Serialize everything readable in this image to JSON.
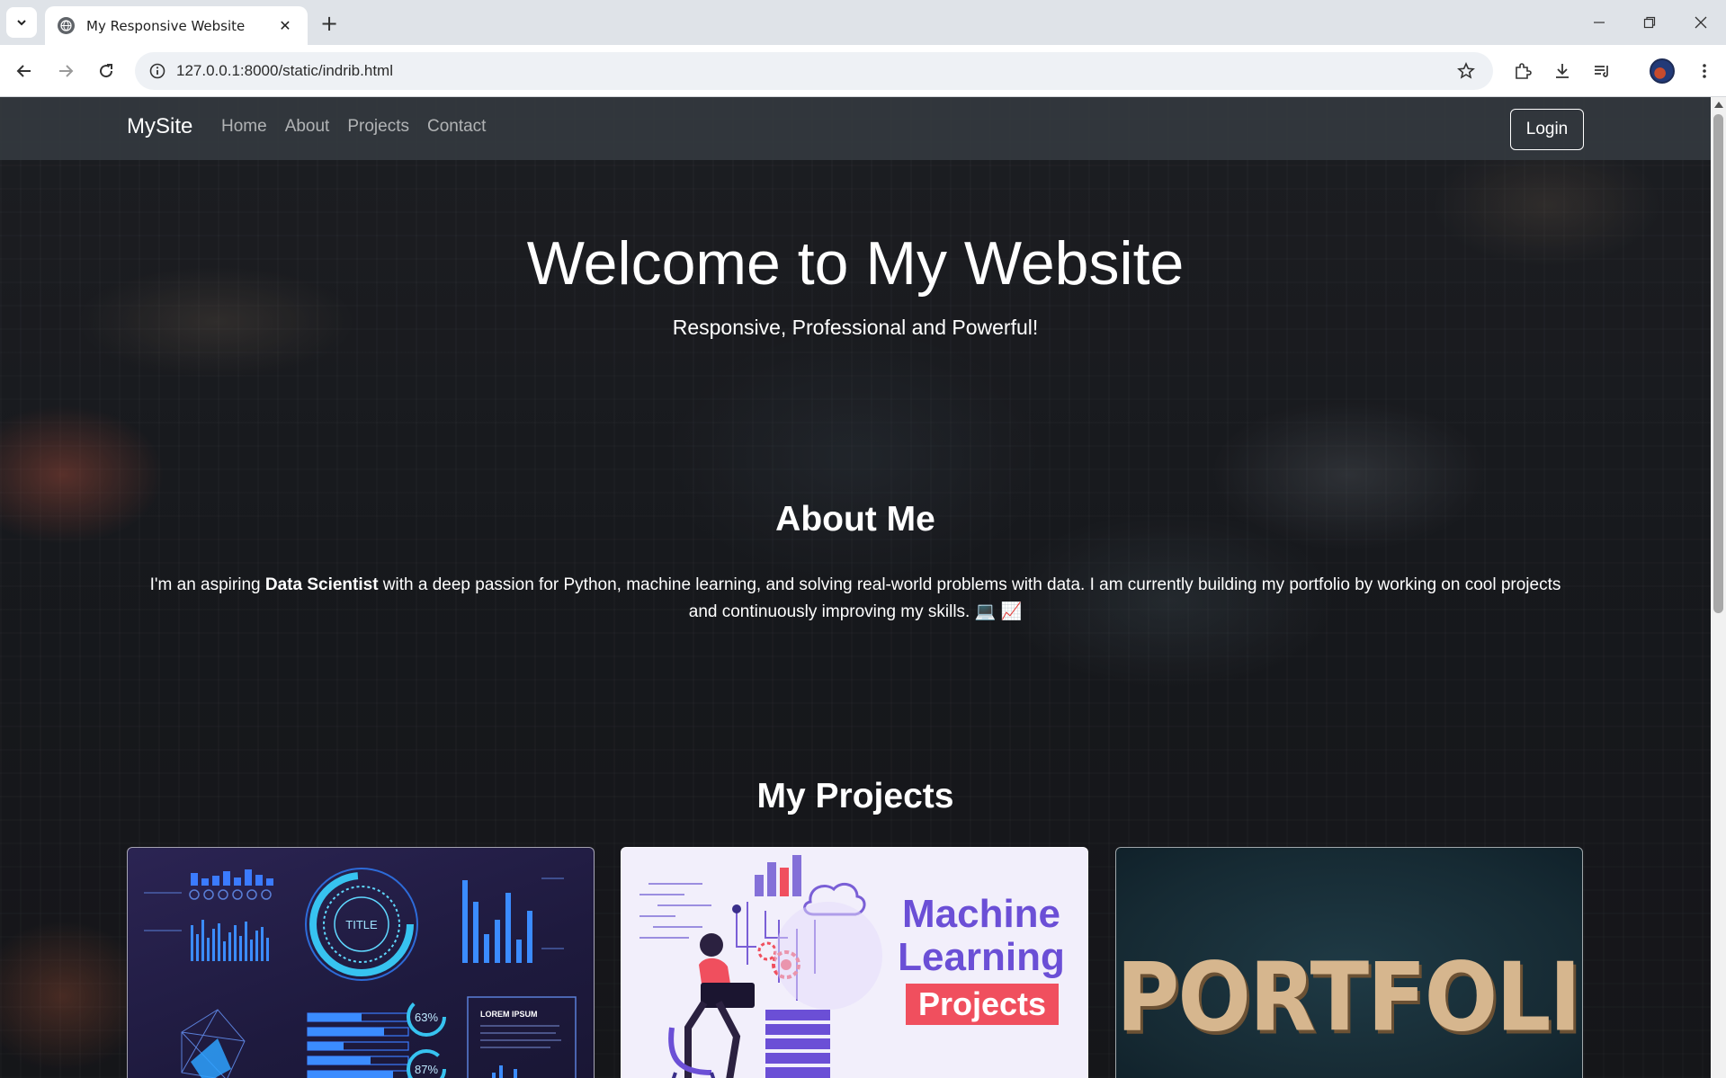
{
  "browser": {
    "tab_title": "My Responsive Website",
    "url": "127.0.0.1:8000/static/indrib.html"
  },
  "site": {
    "brand": "MySite",
    "nav": [
      "Home",
      "About",
      "Projects",
      "Contact"
    ],
    "login": "Login"
  },
  "hero": {
    "title": "Welcome to My Website",
    "subtitle": "Responsive, Professional and Powerful!"
  },
  "about": {
    "title": "About Me",
    "text_before": "I'm an aspiring ",
    "text_bold": "Data Scientist",
    "text_after": " with a deep passion for Python, machine learning, and solving real-world problems with data. I am currently building my portfolio by working on cool projects and continuously improving my skills. 💻 📈"
  },
  "projects": {
    "title": "My Projects",
    "cards": [
      {
        "dial_label": "TITLE",
        "pct1": "63%",
        "pct2": "87%",
        "box_label": "LOREM IPSUM"
      },
      {
        "line1": "Machine",
        "line2": "Learning",
        "tag": "Projects"
      },
      {
        "word": "PORTFOLIO"
      }
    ]
  },
  "colors": {
    "nav_bg": "#343a40",
    "ml_purple": "#6b4fd6",
    "projects_red": "#f04f5e"
  }
}
